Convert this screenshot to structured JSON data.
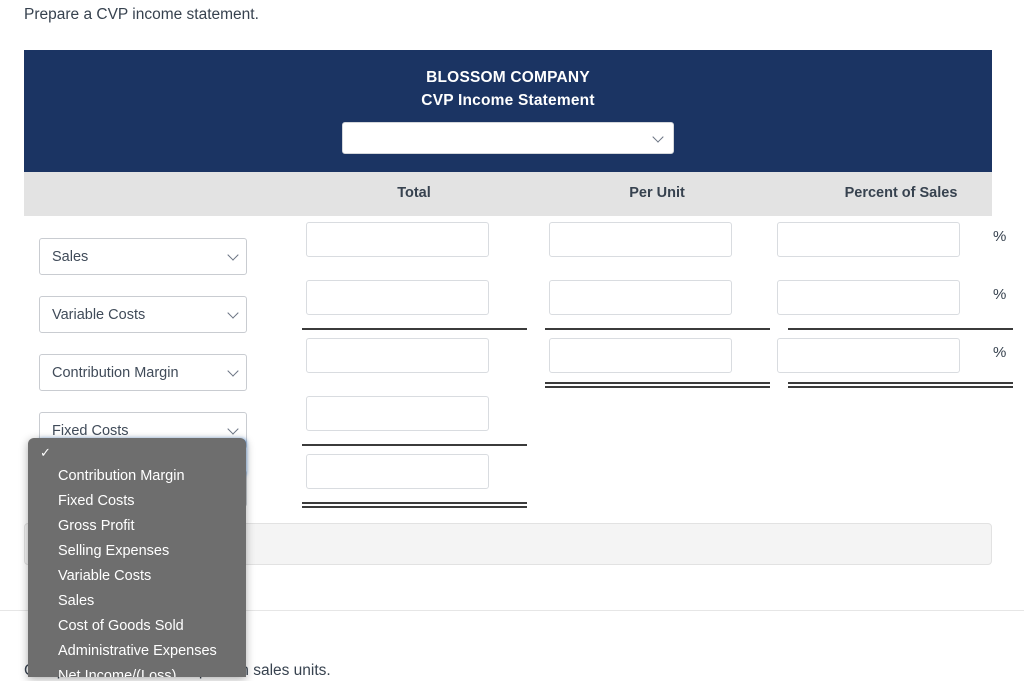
{
  "prompt": "Prepare a CVP income statement.",
  "statement": {
    "company": "BLOSSOM COMPANY",
    "title": "CVP Income Statement",
    "period_select_value": "",
    "columns": {
      "total": "Total",
      "per_unit": "Per Unit",
      "percent_of_sales": "Percent of Sales"
    },
    "rows": [
      {
        "label": "Sales",
        "total_symbol": "$",
        "total_value": "",
        "unit_symbol": "$",
        "unit_value": "",
        "pct_value": "",
        "pct_symbol": "%"
      },
      {
        "label": "Variable Costs",
        "total_symbol": "",
        "total_value": "",
        "unit_symbol": "",
        "unit_value": "",
        "pct_value": "",
        "pct_symbol": "%"
      },
      {
        "label": "Contribution Margin",
        "total_symbol": "",
        "total_value": "",
        "unit_symbol": "$",
        "unit_value": "",
        "pct_value": "",
        "pct_symbol": "%"
      },
      {
        "label": "Fixed Costs",
        "total_symbol": "",
        "total_value": "",
        "unit_symbol": "",
        "unit_value": "",
        "pct_value": "",
        "pct_symbol": ""
      },
      {
        "label": "",
        "total_symbol": "$",
        "total_value": "",
        "unit_symbol": "",
        "unit_value": "",
        "pct_value": "",
        "pct_symbol": ""
      }
    ]
  },
  "dropdown": {
    "open": true,
    "selected": "",
    "check_glyph": "✓",
    "options": [
      "",
      "Contribution Margin",
      "Fixed Costs",
      "Gross Profit",
      "Selling Expenses",
      "Variable Costs",
      "Sales",
      "Cost of Goods Sold",
      "Administrative Expenses",
      "Net Income/(Loss)"
    ]
  },
  "bottom_text": "Compute the break-even point in sales units.",
  "colors": {
    "header_navy": "#1b3463",
    "column_band": "#e3e3e3",
    "dropdown_gray": "#6e6e6e",
    "focus_blue": "#4a90e2",
    "panel_gray": "#f4f4f4"
  }
}
